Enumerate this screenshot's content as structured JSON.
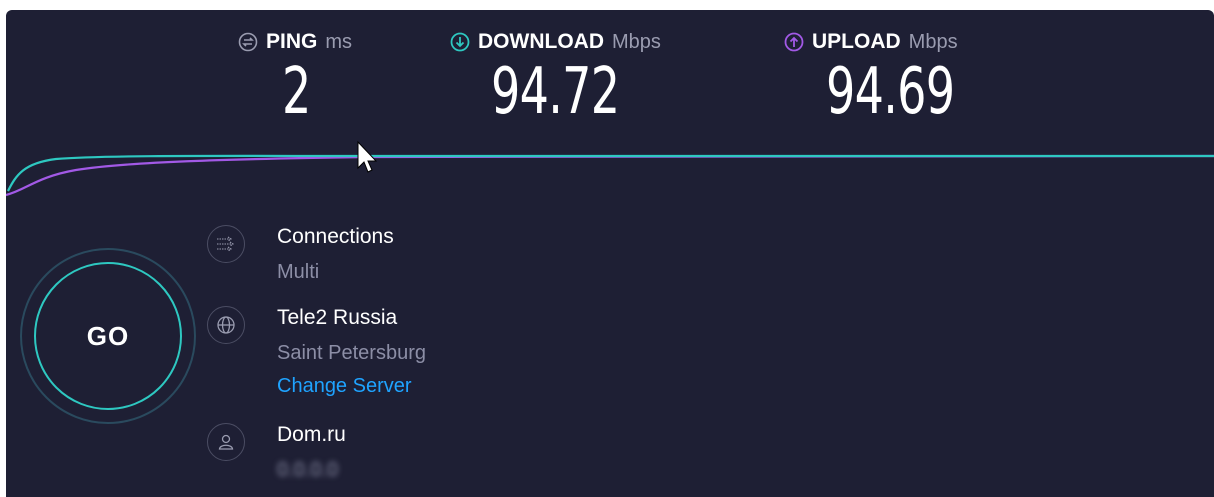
{
  "metrics": {
    "ping": {
      "label": "PING",
      "unit": "ms",
      "value": "2",
      "icon": "ping-icon",
      "color": "#9a9cb0"
    },
    "download": {
      "label": "DOWNLOAD",
      "unit": "Mbps",
      "value": "94.72",
      "icon": "download-arrow-icon",
      "color": "#2ec8c1"
    },
    "upload": {
      "label": "UPLOAD",
      "unit": "Mbps",
      "value": "94.69",
      "icon": "upload-arrow-icon",
      "color": "#a259e6"
    }
  },
  "go_button": {
    "label": "GO"
  },
  "connections": {
    "label": "Connections",
    "value": "Multi",
    "icon": "connections-icon"
  },
  "server": {
    "name": "Tele2 Russia",
    "location": "Saint Petersburg",
    "change_label": "Change Server",
    "icon": "globe-icon"
  },
  "isp": {
    "name": "Dom.ru",
    "ip": "0.0.0.0",
    "icon": "user-icon"
  },
  "colors": {
    "background": "#1e1f34",
    "download_line": "#2ec8c1",
    "upload_line": "#a259e6",
    "link": "#1fa3ff"
  }
}
